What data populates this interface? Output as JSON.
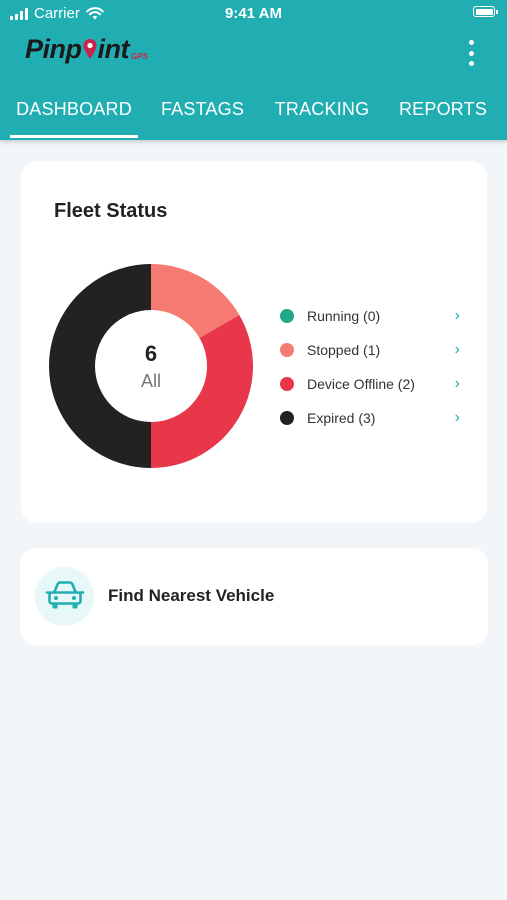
{
  "status_bar": {
    "carrier": "Carrier",
    "time": "9:41 AM"
  },
  "brand": {
    "name_part1": "Pinp",
    "name_part2": "int",
    "suffix": "GPS"
  },
  "tabs": [
    {
      "label": "DASHBOARD",
      "active": true
    },
    {
      "label": "FASTAGS",
      "active": false
    },
    {
      "label": "TRACKING",
      "active": false
    },
    {
      "label": "REPORTS",
      "active": false
    }
  ],
  "fleet_status": {
    "title": "Fleet Status",
    "total": "6",
    "total_label": "All",
    "legend": [
      {
        "label": "Running (0)",
        "color": "#1fa88a",
        "count": 0
      },
      {
        "label": "Stopped (1)",
        "color": "#f47a72",
        "count": 1
      },
      {
        "label": "Device Offline (2)",
        "color": "#e8374a",
        "count": 2
      },
      {
        "label": "Expired (3)",
        "color": "#222222",
        "count": 3
      }
    ]
  },
  "nearest": {
    "label": "Find Nearest Vehicle",
    "icon": "car-icon"
  },
  "colors": {
    "accent": "#21aeb3",
    "background": "#f3f6f9"
  }
}
